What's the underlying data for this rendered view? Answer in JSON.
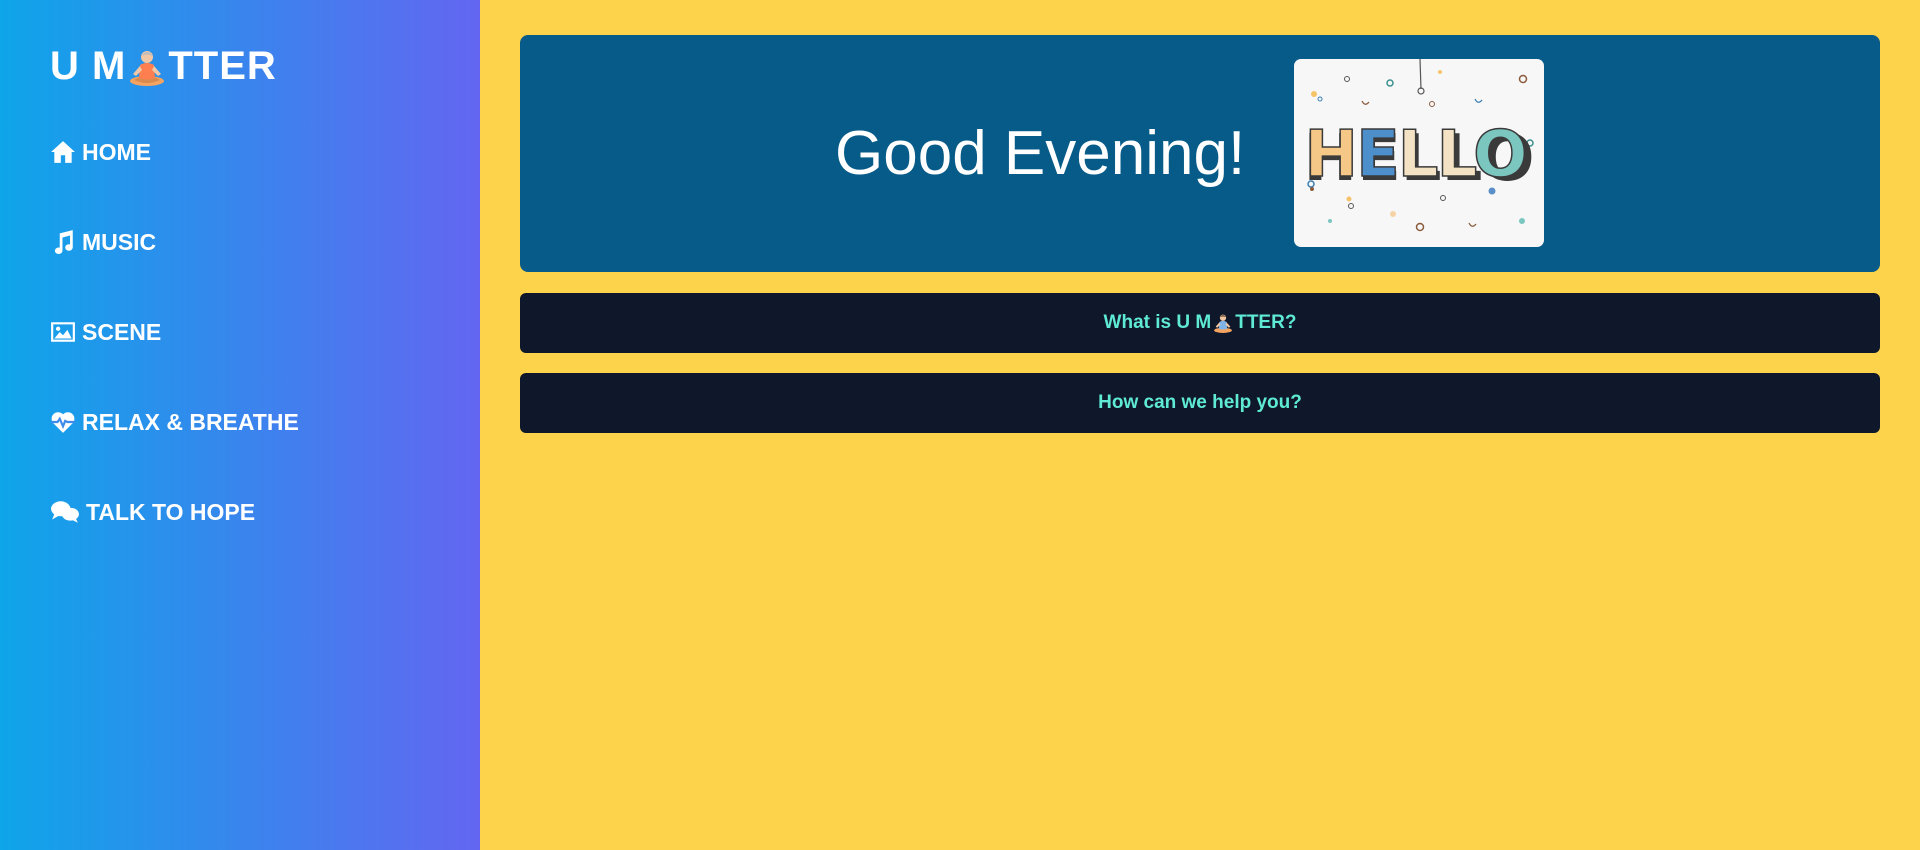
{
  "sidebar": {
    "logo": {
      "prefix": "U M",
      "suffix": "TTER",
      "glyph_icon": "meditating-person-icon"
    },
    "items": [
      {
        "label": "HOME",
        "icon": "home-icon"
      },
      {
        "label": "MUSIC",
        "icon": "music-note-icon"
      },
      {
        "label": "SCENE",
        "icon": "image-icon"
      },
      {
        "label": "RELAX & BREATHE",
        "icon": "heartbeat-icon"
      },
      {
        "label": "TALK TO HOPE",
        "icon": "chat-bubbles-icon"
      }
    ]
  },
  "hero": {
    "greeting": "Good Evening!",
    "image_text": "HELLO"
  },
  "buttons": {
    "what_is": {
      "prefix": "What is U M",
      "suffix": "TTER?"
    },
    "help": "How can we help you?"
  },
  "colors": {
    "background": "#FDD34C",
    "sidebar_gradient_start": "#0EA5E9",
    "sidebar_gradient_end": "#6366F1",
    "hero_background": "#075B88",
    "button_background": "#0F172A",
    "button_text": "#5EEAD4"
  }
}
